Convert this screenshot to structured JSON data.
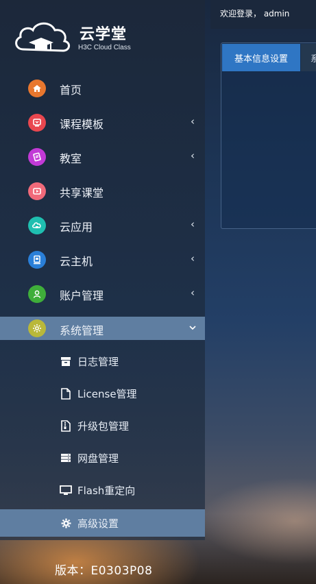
{
  "brand": {
    "title": "云学堂",
    "subtitle": "H3C Cloud Class"
  },
  "menu": [
    {
      "label": "首页",
      "icon": "home-icon",
      "color": "#e8772e",
      "has_submenu": false
    },
    {
      "label": "课程模板",
      "icon": "course-template-icon",
      "color": "#e9474f",
      "has_submenu": true
    },
    {
      "label": "教室",
      "icon": "classroom-icon",
      "color": "#c23ad6",
      "has_submenu": true
    },
    {
      "label": "共享课堂",
      "icon": "shared-class-icon",
      "color": "#f06a7a",
      "has_submenu": false
    },
    {
      "label": "云应用",
      "icon": "cloud-app-icon",
      "color": "#1fbfb0",
      "has_submenu": true
    },
    {
      "label": "云主机",
      "icon": "cloud-host-icon",
      "color": "#2a7fd8",
      "has_submenu": true
    },
    {
      "label": "账户管理",
      "icon": "user-icon",
      "color": "#3fae3a",
      "has_submenu": true
    },
    {
      "label": "系统管理",
      "icon": "settings-icon",
      "color": "#b9b83a",
      "has_submenu": true,
      "expanded": true
    }
  ],
  "submenu": [
    {
      "label": "日志管理",
      "icon": "archive-icon"
    },
    {
      "label": "License管理",
      "icon": "file-icon"
    },
    {
      "label": "升级包管理",
      "icon": "zip-file-icon"
    },
    {
      "label": "网盘管理",
      "icon": "server-icon"
    },
    {
      "label": "Flash重定向",
      "icon": "monitor-icon"
    },
    {
      "label": "高级设置",
      "icon": "gear-icon",
      "active": true
    }
  ],
  "version": "版本：E0303P08",
  "header": {
    "welcome": "欢迎登录， admin"
  },
  "tabs": {
    "active": "基本信息设置",
    "next": "系"
  },
  "colors": {
    "accent_tab": "#2f76c4",
    "active_menu_bg": "#5f7ea1"
  }
}
